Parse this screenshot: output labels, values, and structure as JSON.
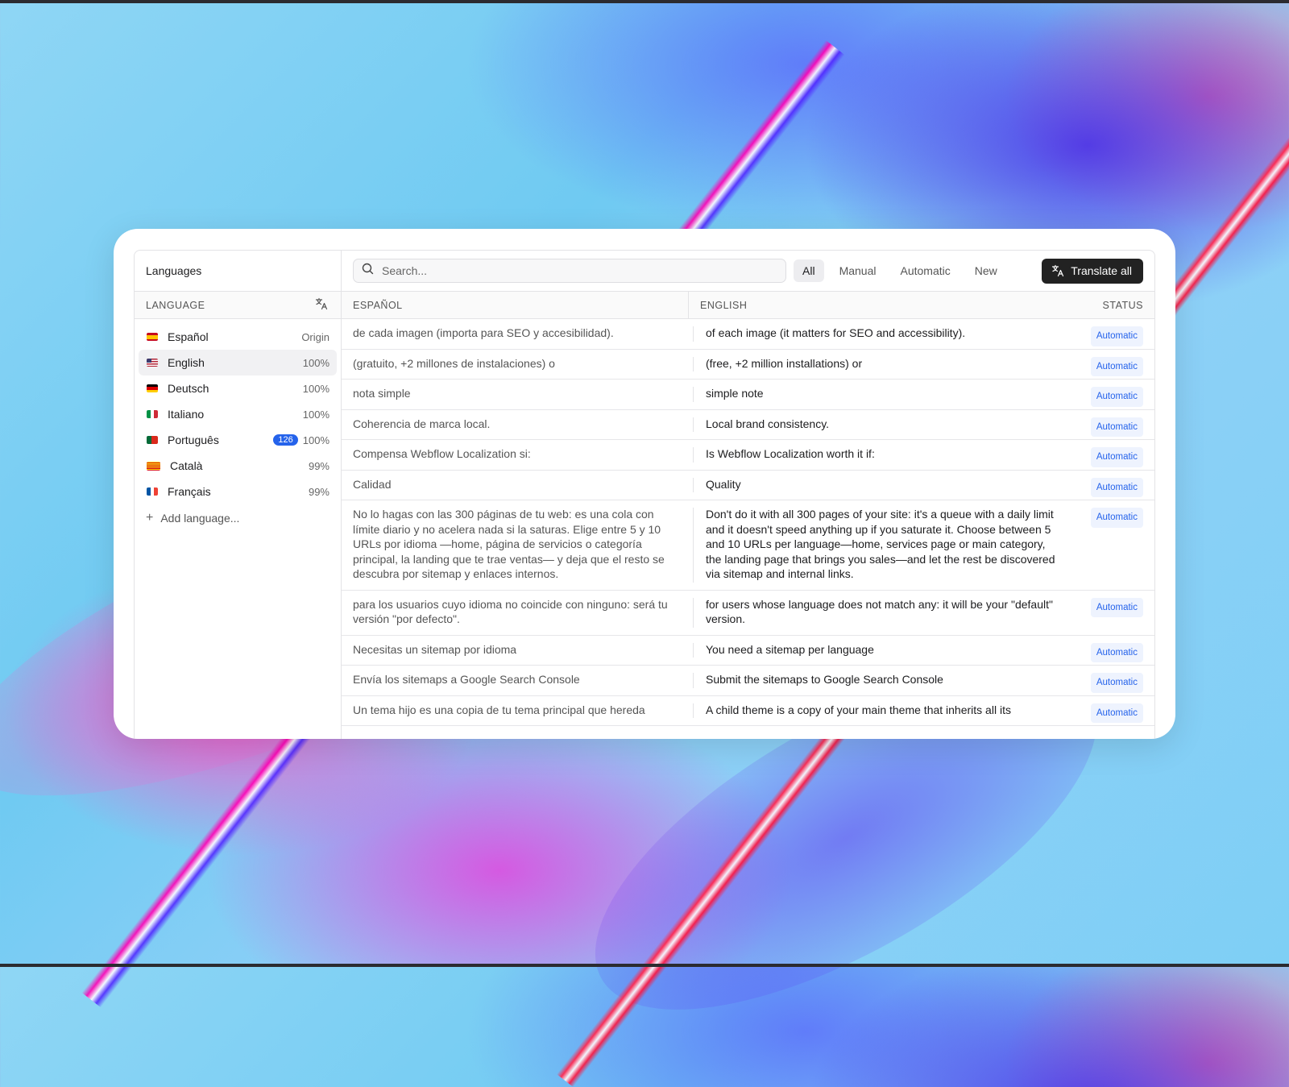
{
  "sidebar": {
    "title": "Languages",
    "column_header": "LANGUAGE",
    "column_icon": "translate-icon",
    "languages": [
      {
        "name": "Español",
        "value": "Origin",
        "flag": "es",
        "active": false
      },
      {
        "name": "English",
        "value": "100%",
        "flag": "us",
        "active": true
      },
      {
        "name": "Deutsch",
        "value": "100%",
        "flag": "de",
        "active": false
      },
      {
        "name": "Italiano",
        "value": "100%",
        "flag": "it",
        "active": false
      },
      {
        "name": "Português",
        "value": "100%",
        "flag": "pt",
        "active": false,
        "badge": "126"
      },
      {
        "name": "Català",
        "value": "99%",
        "flag": "ca",
        "active": false
      },
      {
        "name": "Français",
        "value": "99%",
        "flag": "fr",
        "active": false
      }
    ],
    "add_language": "Add language..."
  },
  "toolbar": {
    "search_placeholder": "Search...",
    "filters": [
      "All",
      "Manual",
      "Automatic",
      "New"
    ],
    "active_filter": "All",
    "translate_all": "Translate all"
  },
  "table": {
    "headers": {
      "source": "ESPAÑOL",
      "target": "ENGLISH",
      "status": "STATUS"
    },
    "rows": [
      {
        "es": "de cada imagen (importa para SEO y accesibilidad).",
        "en": "of each image (it matters for SEO and accessibility).",
        "status": "Automatic"
      },
      {
        "es": "(gratuito, +2 millones de instalaciones) o",
        "en": "(free, +2 million installations) or",
        "status": "Automatic"
      },
      {
        "es": "nota simple",
        "en": "simple note",
        "status": "Automatic"
      },
      {
        "es": "Coherencia de marca local.",
        "en": "Local brand consistency.",
        "status": "Automatic"
      },
      {
        "es": "Compensa Webflow Localization si:",
        "en": "Is Webflow Localization worth it if:",
        "status": "Automatic"
      },
      {
        "es": "Calidad",
        "en": "Quality",
        "status": "Automatic"
      },
      {
        "es": "No lo hagas con las 300 páginas de tu web: es una cola con límite diario y no acelera nada si la saturas. Elige entre 5 y 10 URLs por idioma —home, página de servicios o categoría principal, la landing que te trae ventas— y deja que el resto se descubra por sitemap y enlaces internos.",
        "en": "Don't do it with all 300 pages of your site: it's a queue with a daily limit and it doesn't speed anything up if you saturate it. Choose between 5 and 10 URLs per language—home, services page or main category, the landing page that brings you sales—and let the rest be discovered via sitemap and internal links.",
        "status": "Automatic"
      },
      {
        "es": "para los usuarios cuyo idioma no coincide con ninguno: será tu versión \"por defecto\".",
        "en": "for users whose language does not match any: it will be your \"default\" version.",
        "status": "Automatic"
      },
      {
        "es": "Necesitas un sitemap por idioma",
        "en": "You need a sitemap per language",
        "status": "Automatic"
      },
      {
        "es": "Envía los sitemaps a Google Search Console",
        "en": "Submit the sitemaps to Google Search Console",
        "status": "Automatic"
      },
      {
        "es": "Un tema hijo es una copia de tu tema principal que hereda",
        "en": "A child theme is a copy of your main theme that inherits all its",
        "status": "Automatic"
      }
    ]
  },
  "colors": {
    "accent": "#2563eb",
    "button_dark": "#222222"
  }
}
